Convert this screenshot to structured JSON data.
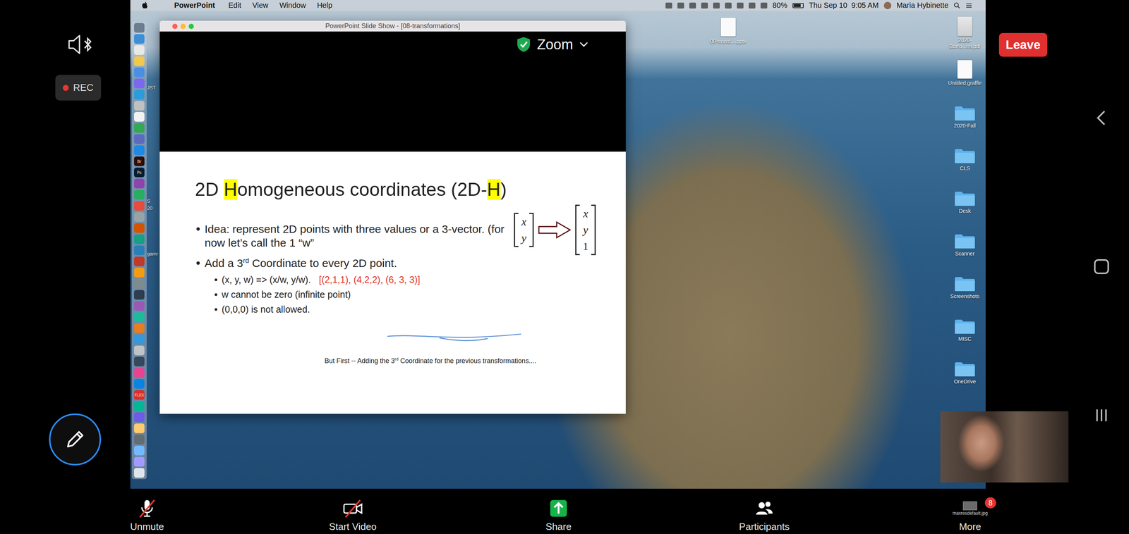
{
  "menu_bar": {
    "app": "PowerPoint",
    "menus": [
      "Edit",
      "View",
      "Window",
      "Help"
    ],
    "battery": "80%",
    "clock": "Thu Sep 10  9:05 AM",
    "user": "Maria Hybinette"
  },
  "slideshow_window": {
    "title": "PowerPoint Slide Show - [08-transformations]"
  },
  "slide": {
    "title": [
      {
        "text": "2D ",
        "highlight": false
      },
      {
        "text": "H",
        "highlight": true
      },
      {
        "text": "omogeneous coordinates (2D-",
        "highlight": false
      },
      {
        "text": "H",
        "highlight": true
      },
      {
        "text": ")",
        "highlight": false
      }
    ],
    "bullets": [
      {
        "level": 1,
        "parts": [
          {
            "text": "Idea: represent 2D points with three values or a 3-vector. (for now let’s call the 1 “w”",
            "kind": "plain"
          }
        ]
      },
      {
        "level": 1,
        "parts": [
          {
            "text": "Add a 3",
            "kind": "plain"
          },
          {
            "text": "rd",
            "kind": "sup"
          },
          {
            "text": " Coordinate to every 2D point.",
            "kind": "plain"
          }
        ]
      },
      {
        "level": 2,
        "parts": [
          {
            "text": "(x, y, w) => (x/w, y/w).",
            "kind": "plain"
          },
          {
            "text": "[(2,1,1), (4,2,2), (6, 3, 3)]",
            "kind": "red"
          }
        ]
      },
      {
        "level": 2,
        "parts": [
          {
            "text": "w cannot be zero (infinite point)",
            "kind": "plain"
          }
        ]
      },
      {
        "level": 2,
        "parts": [
          {
            "text": "(0,0,0) is not allowed.",
            "kind": "plain"
          }
        ]
      }
    ],
    "matrix_from": [
      "x",
      "y"
    ],
    "matrix_to": [
      "x",
      "y",
      "1"
    ],
    "footer": [
      {
        "text": "But First -- Adding the 3",
        "kind": "plain"
      },
      {
        "text": "rd",
        "kind": "sup"
      },
      {
        "text": " Coordinate for the previous transformations....",
        "kind": "plain"
      }
    ]
  },
  "dock": {
    "text_icons": [
      "Br",
      "Ps",
      "FLEX"
    ]
  },
  "desktop_left_labels": [
    "JST",
    "S",
    "20",
    "gamr"
  ],
  "desktop_file": {
    "label": "08-transf....pptx"
  },
  "desktop_icons": [
    {
      "label": "2020-Borro...es.pdf",
      "kind": "pdf"
    },
    {
      "label": "Untitled.graffle",
      "kind": "file"
    },
    {
      "label": "2020-Fall",
      "kind": "folder"
    },
    {
      "label": "CLS",
      "kind": "folder"
    },
    {
      "label": "Desk",
      "kind": "folder"
    },
    {
      "label": "Scanner",
      "kind": "folder"
    },
    {
      "label": "Screenshots",
      "kind": "folder"
    },
    {
      "label": "MISC",
      "kind": "folder"
    },
    {
      "label": "OneDrive",
      "kind": "folder"
    }
  ],
  "zoom": {
    "title": "Zoom",
    "rec": "REC",
    "leave": "Leave",
    "more_thumbnail_label": "maxresdefault.jpg",
    "toolbar": [
      {
        "label": "Unmute",
        "kind": "mic",
        "off": true
      },
      {
        "label": "Start Video",
        "kind": "video",
        "off": true
      },
      {
        "label": "Share",
        "kind": "share",
        "off": false
      },
      {
        "label": "Participants",
        "kind": "participants",
        "off": false
      },
      {
        "label": "More",
        "kind": "more",
        "off": false,
        "badge": "8"
      }
    ]
  }
}
